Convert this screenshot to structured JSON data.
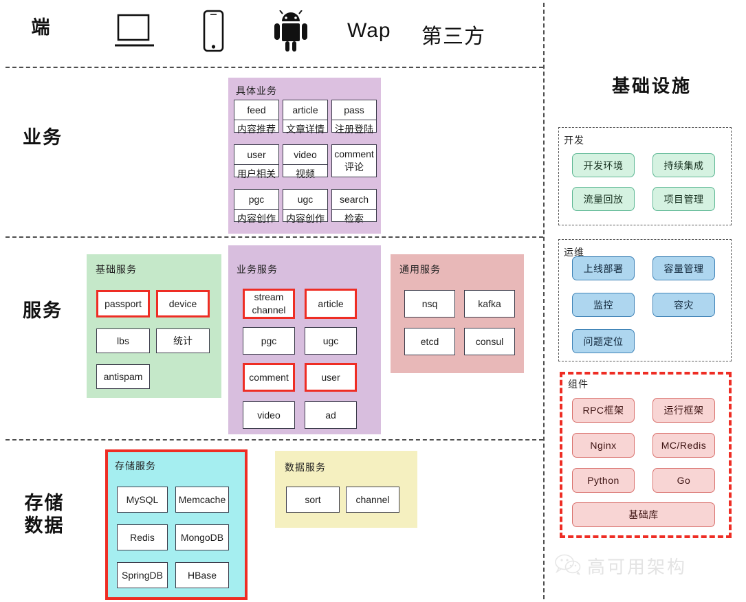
{
  "bands": {
    "client": "端",
    "business": "业务",
    "service": "服务",
    "storage_line1": "存储",
    "storage_line2": "数据"
  },
  "clients": {
    "laptop_icon": "laptop-icon",
    "phone_icon": "mobile-phone-icon",
    "android_icon": "android-robot-icon",
    "wap": "Wap",
    "third_party": "第三方"
  },
  "infra": {
    "title": "基础设施",
    "dev": {
      "title": "开发",
      "items": [
        "开发环境",
        "持续集成",
        "流量回放",
        "项目管理"
      ]
    },
    "ops": {
      "title": "运维",
      "items": [
        "上线部署",
        "容量管理",
        "监控",
        "容灾",
        "问题定位"
      ]
    },
    "components": {
      "title": "组件",
      "items": [
        "RPC框架",
        "运行框架",
        "Nginx",
        "MC/Redis",
        "Python",
        "Go"
      ],
      "wide_item": "基础库"
    }
  },
  "business": {
    "title": "具体业务",
    "items": [
      {
        "en": "feed",
        "cn": "内容推荐",
        "split": true
      },
      {
        "en": "article",
        "cn": "文章详情",
        "split": true
      },
      {
        "en": "pass",
        "cn": "注册登陆",
        "split": true
      },
      {
        "en": "user",
        "cn": "用户相关",
        "split": true
      },
      {
        "en": "video",
        "cn": "视频",
        "split": true
      },
      {
        "en": "comment",
        "cn": "评论",
        "split": false
      },
      {
        "en": "pgc",
        "cn": "内容创作",
        "split": true
      },
      {
        "en": "ugc",
        "cn": "内容创作",
        "split": true
      },
      {
        "en": "search",
        "cn": "检索",
        "split": true
      }
    ]
  },
  "base_service": {
    "title": "基础服务",
    "items": [
      {
        "label": "passport",
        "highlight": true
      },
      {
        "label": "device",
        "highlight": true
      },
      {
        "label": "lbs",
        "highlight": false
      },
      {
        "label": "统计",
        "highlight": false
      },
      {
        "label": "antispam",
        "highlight": false
      }
    ]
  },
  "biz_service": {
    "title": "业务服务",
    "items": [
      {
        "label": "stream channel",
        "line1": "stream",
        "line2": "channel",
        "highlight": true
      },
      {
        "label": "article",
        "highlight": true
      },
      {
        "label": "pgc",
        "highlight": false
      },
      {
        "label": "ugc",
        "highlight": false
      },
      {
        "label": "comment",
        "highlight": true
      },
      {
        "label": "user",
        "highlight": true
      },
      {
        "label": "video",
        "highlight": false
      },
      {
        "label": "ad",
        "highlight": false
      }
    ]
  },
  "common_service": {
    "title": "通用服务",
    "items": [
      "nsq",
      "kafka",
      "etcd",
      "consul"
    ]
  },
  "storage_service": {
    "title": "存储服务",
    "items": [
      "MySQL",
      "Memcache",
      "Redis",
      "MongoDB",
      "SpringDB",
      "HBase"
    ]
  },
  "data_service": {
    "title": "数据服务",
    "items": [
      "sort",
      "channel"
    ]
  },
  "watermark": {
    "icon": "wechat-icon",
    "text": "高可用架构"
  },
  "colors": {
    "purple_panel": "#dcc0e0",
    "green_panel": "#c5e8c9",
    "pink_panel": "#e8b8b8",
    "cyan_panel": "#a5eef0",
    "yellow_panel": "#f5f0c0",
    "highlight_red": "#ee2d24",
    "dev_green": "#d5f2e1",
    "ops_blue": "#aed6ef",
    "component_pink": "#f8d5d4"
  }
}
